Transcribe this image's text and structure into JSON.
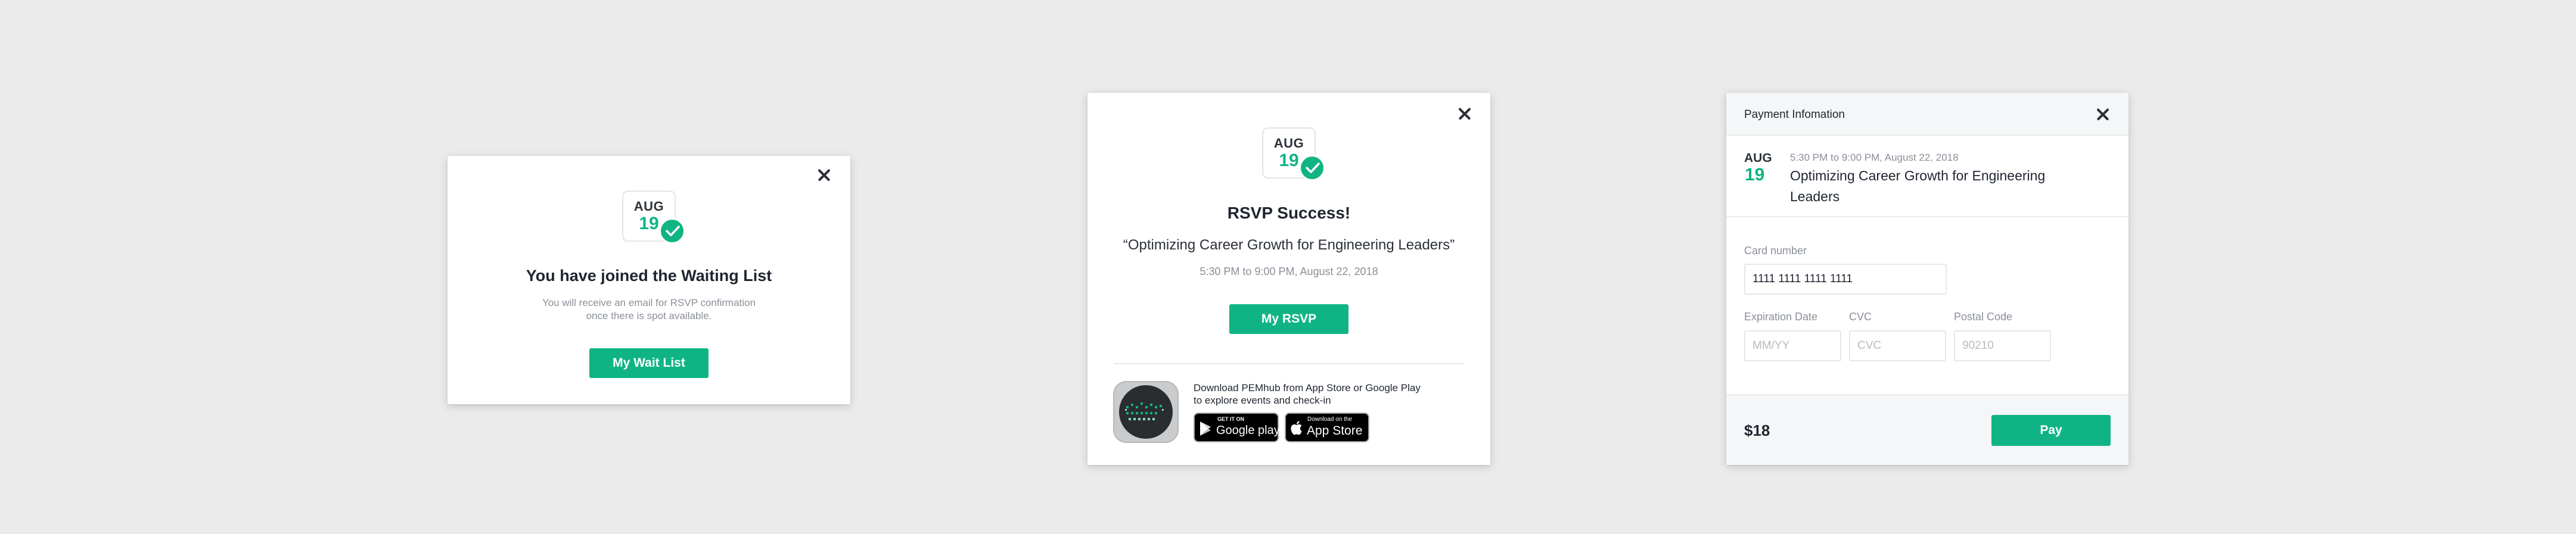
{
  "waitlist_modal": {
    "calendar": {
      "month": "AUG",
      "day": "19"
    },
    "title": "You have joined the Waiting List",
    "message_line1": "You will receive an email for RSVP confirmation",
    "message_line2": "once there is spot available.",
    "button_label": "My Wait List"
  },
  "rsvp_modal": {
    "calendar": {
      "month": "AUG",
      "day": "19"
    },
    "title": "RSVP Success!",
    "event_title": "“Optimizing Career Growth for Engineering Leaders”",
    "event_time": "5:30 PM to 9:00 PM, August 22, 2018",
    "button_label": "My RSVP",
    "download_line1": "Download PEMhub from App Store or Google Play",
    "download_line2": "to explore events and check-in",
    "google_play": {
      "small": "GET IT ON",
      "big": "Google play"
    },
    "app_store": {
      "small": "Download on the",
      "big": "App Store"
    }
  },
  "payment_modal": {
    "header_title": "Payment Infomation",
    "event_month": "AUG",
    "event_day": "19",
    "event_time": "5:30 PM to 9:00 PM, August 22, 2018",
    "event_title_line1": "Optimizing Career Growth for Engineering",
    "event_title_line2": "Leaders",
    "card_number_label": "Card number",
    "card_number_value": "1111 1111 1111 1111",
    "expiration_label": "Expiration Date",
    "expiration_placeholder": "MM/YY",
    "cvc_label": "CVC",
    "cvc_placeholder": "CVC",
    "postal_label": "Postal Code",
    "postal_placeholder": "90210",
    "price": "$18",
    "pay_button_label": "Pay"
  },
  "colors": {
    "accent_green": "#10b484",
    "background": "#ebebeb",
    "footer_bg": "#f5f6f7"
  },
  "icons": [
    "close-icon",
    "check-icon",
    "google-play-icon",
    "apple-icon",
    "app-logo-icon"
  ]
}
